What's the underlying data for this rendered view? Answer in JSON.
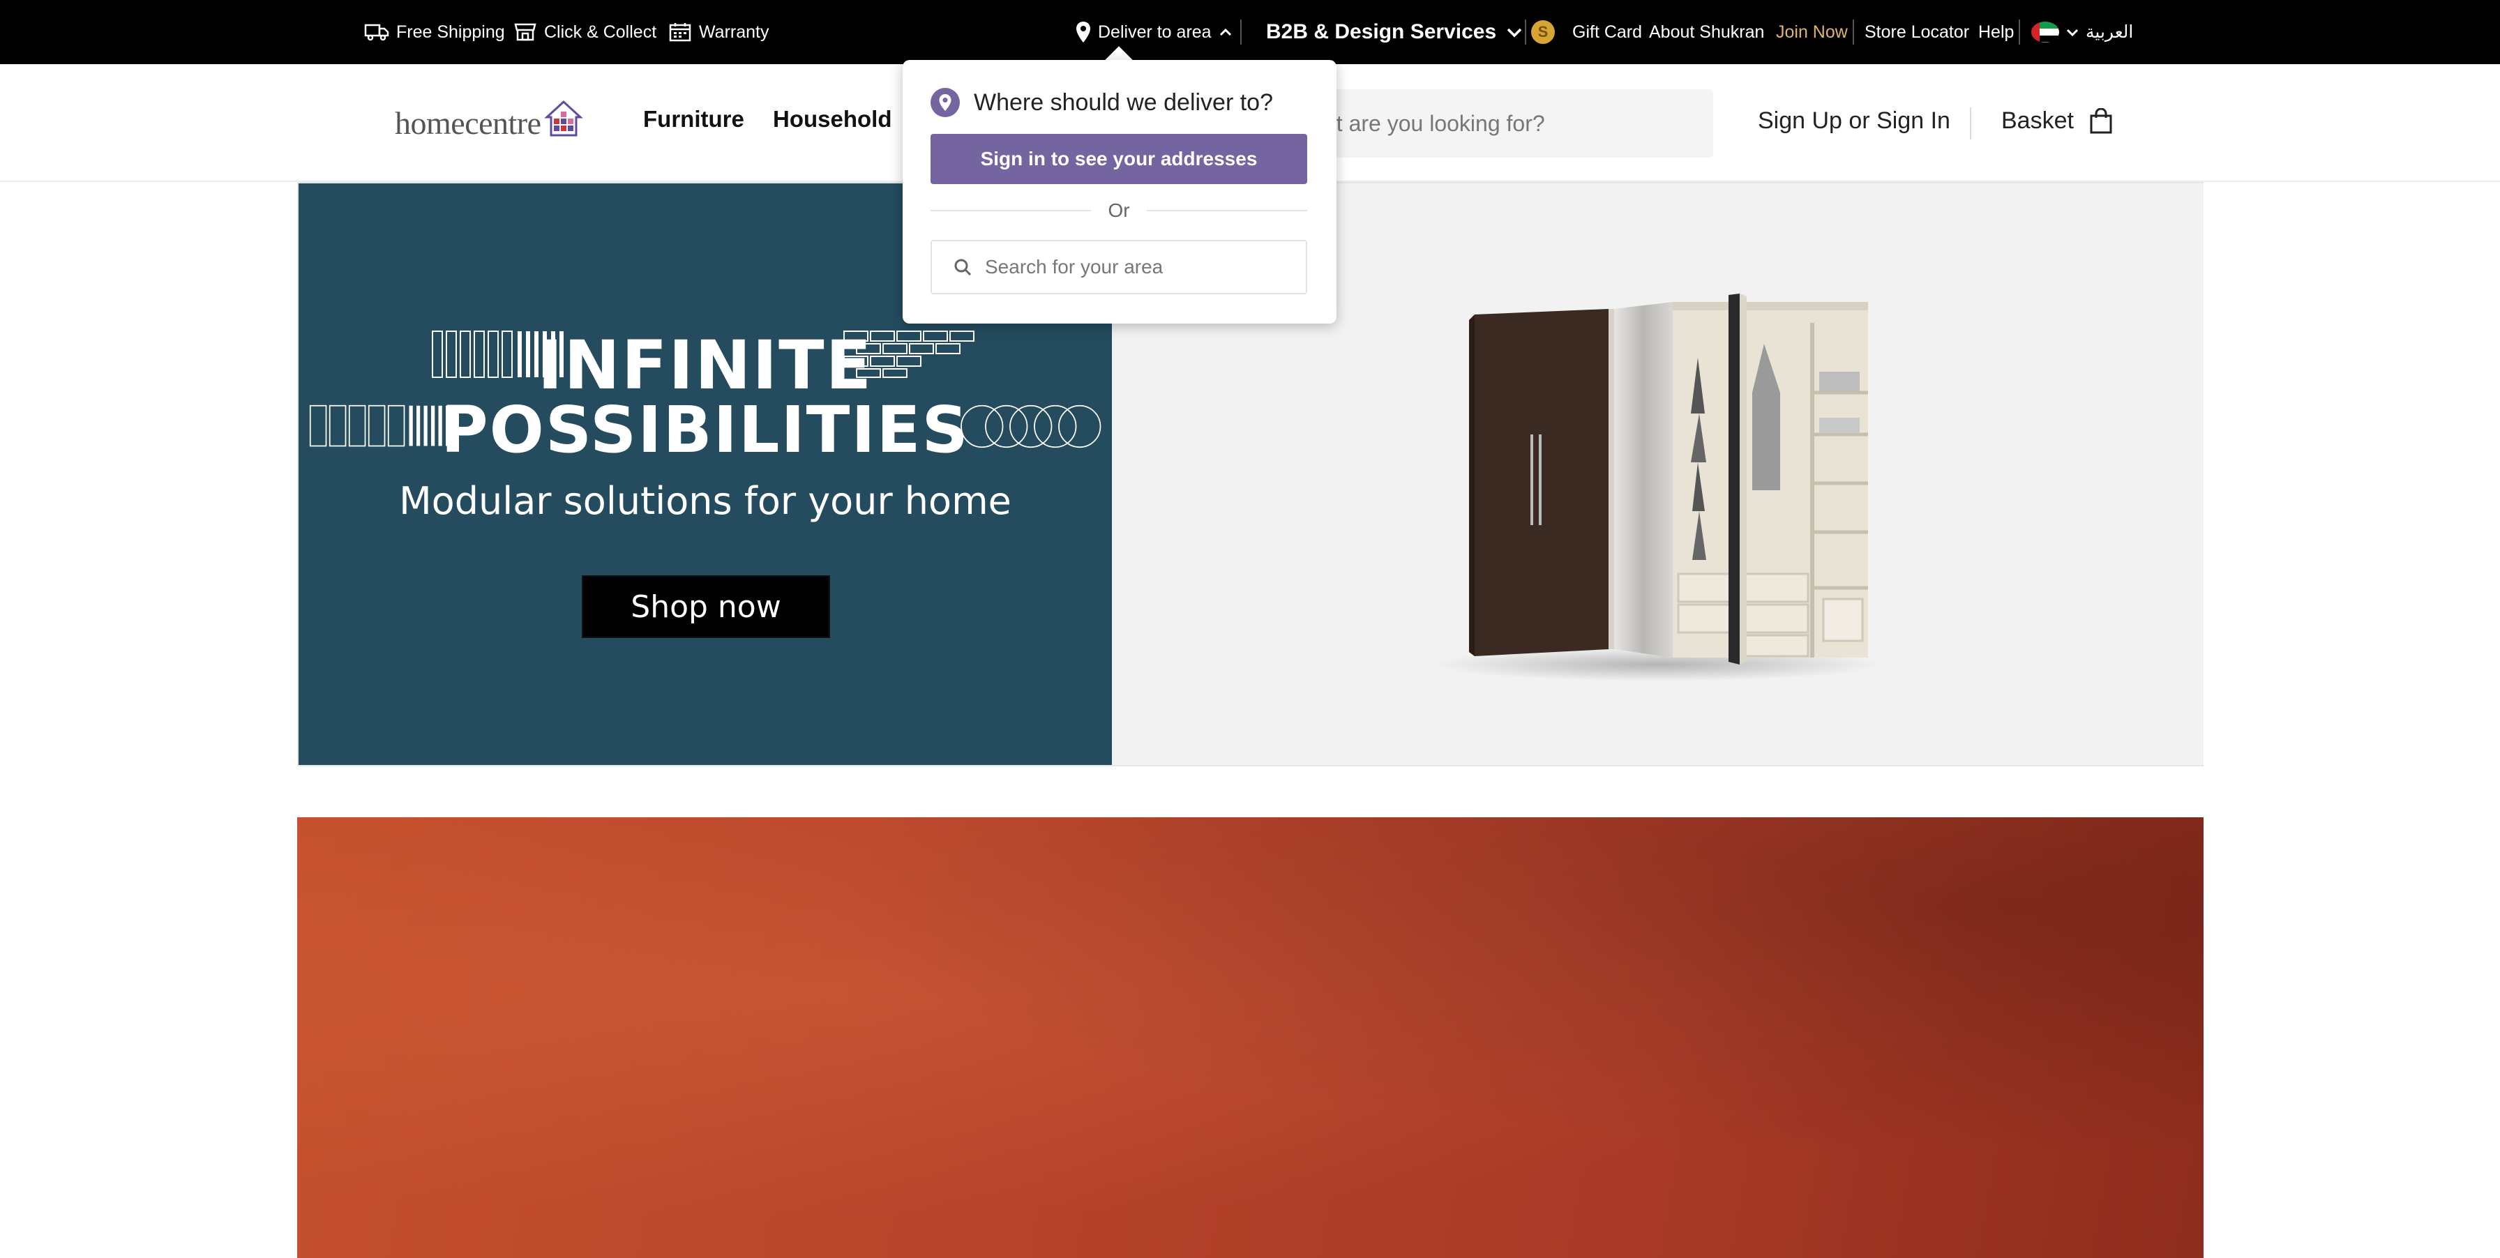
{
  "topbar": {
    "free_shipping": "Free Shipping",
    "click_collect": "Click & Collect",
    "warranty": "Warranty",
    "deliver_to": "Deliver to area",
    "b2b": "B2B & Design Services",
    "shukran_symbol": "S",
    "gift_card": "Gift Card",
    "about_shukran": "About Shukran",
    "join_now": "Join Now",
    "store_locator": "Store Locator",
    "help": "Help",
    "language": "العربية"
  },
  "header": {
    "logo": "homecentre",
    "nav": [
      "Furniture",
      "Household"
    ],
    "search_placeholder": "What are you looking for?",
    "signin": "Sign Up or Sign In",
    "basket": "Basket"
  },
  "banner": {
    "line1": "INFINITE",
    "line2": "POSSIBILITIES",
    "tagline": "Modular solutions for your home",
    "cta": "Shop now"
  },
  "delivery_popover": {
    "title": "Where should we deliver to?",
    "signin_button": "Sign in to see your addresses",
    "or": "Or",
    "search_placeholder": "Search for your area"
  },
  "colors": {
    "accent": "#7464a0",
    "join_now": "#e0b36a",
    "banner_bg": "#244b5e",
    "shukran": "#d6a534"
  }
}
